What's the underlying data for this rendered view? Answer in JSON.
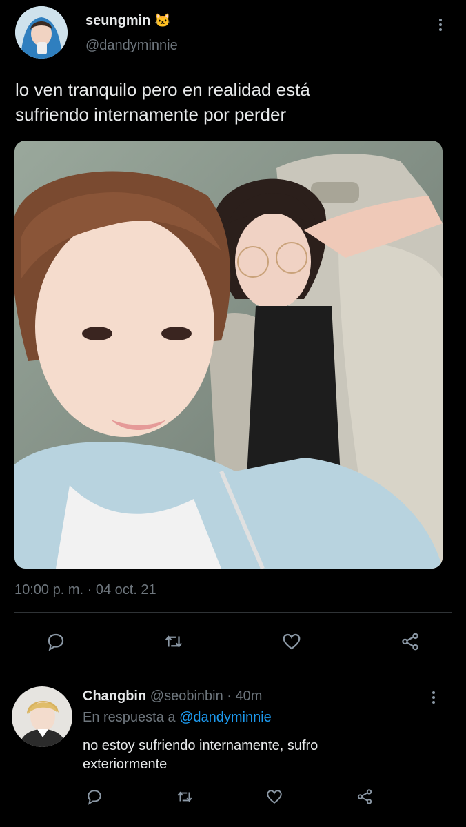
{
  "tweet": {
    "display_name": "seungmin",
    "name_emoji": "🐱",
    "handle": "@dandyminnie",
    "text_line1": "lo ven tranquilo pero en realidad está",
    "text_line2": "sufriendo internamente por perder",
    "timestamp": "10:00 p. m. · 04 oct. 21"
  },
  "reply": {
    "display_name": "Changbin",
    "handle": "@seobinbin",
    "time": "· 40m",
    "replying_prefix": "En respuesta a",
    "replying_to": "@dandyminnie",
    "text_line1": "no estoy sufriendo internamente, sufro",
    "text_line2": "exteriormente"
  },
  "icons": [
    "reply-icon",
    "retweet-icon",
    "like-icon",
    "share-icon",
    "more-options-icon"
  ],
  "colors": {
    "background": "#000000",
    "text": "#e7e9ea",
    "muted": "#6e767d",
    "link": "#1d9bf0",
    "divider": "#2f3336"
  }
}
